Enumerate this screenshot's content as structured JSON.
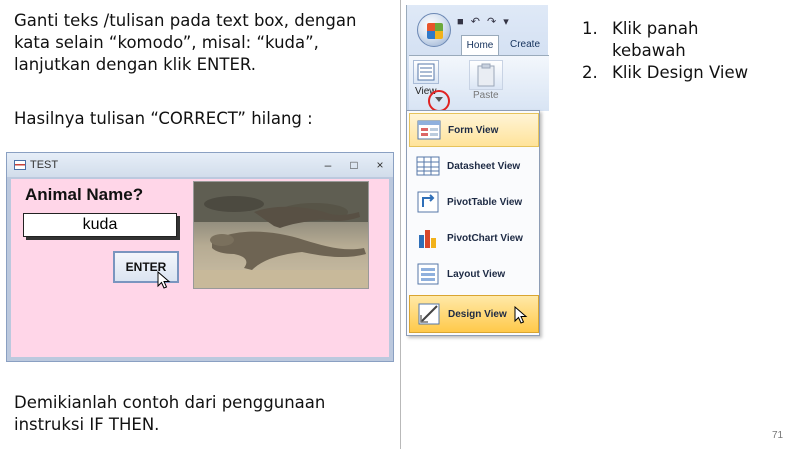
{
  "left": {
    "paragraph1": "Ganti teks /tulisan pada text box, dengan\nkata selain “komodo”, misal: “kuda”,\nlanjutkan dengan klik ENTER.",
    "paragraph2": "Hasilnya tulisan “CORRECT” hilang :",
    "paragraph3": "Demikianlah contoh dari penggunaan\ninstruksi IF THEN."
  },
  "form_window": {
    "title": "TEST",
    "minimize": "–",
    "maximize": "□",
    "close": "×",
    "label": "Animal Name?",
    "textbox_value": "kuda",
    "button_label": "ENTER",
    "image_icon": "komodo-photo"
  },
  "ribbon": {
    "quick_access": "■ ↶ ↷ ▾",
    "tabs": [
      "Home",
      "Create"
    ],
    "view_label": "View",
    "paste_label": "Paste"
  },
  "menu": {
    "items": [
      {
        "label": "Form View",
        "icon": "form-view-icon"
      },
      {
        "label": "Datasheet View",
        "icon": "datasheet-view-icon"
      },
      {
        "label": "PivotTable View",
        "icon": "pivottable-view-icon"
      },
      {
        "label": "PivotChart View",
        "icon": "pivotchart-view-icon"
      },
      {
        "label": "Layout View",
        "icon": "layout-view-icon"
      },
      {
        "label": "Design View",
        "icon": "design-view-icon"
      }
    ]
  },
  "steps": [
    {
      "num": "1.",
      "text": "Klik panah\nkebawah"
    },
    {
      "num": "2.",
      "text": "Klik Design View"
    }
  ],
  "page_number": "71",
  "colors": {
    "form_background": "#ffd6e8",
    "highlight": "#ffc94a",
    "callout_circle": "#e02222"
  }
}
